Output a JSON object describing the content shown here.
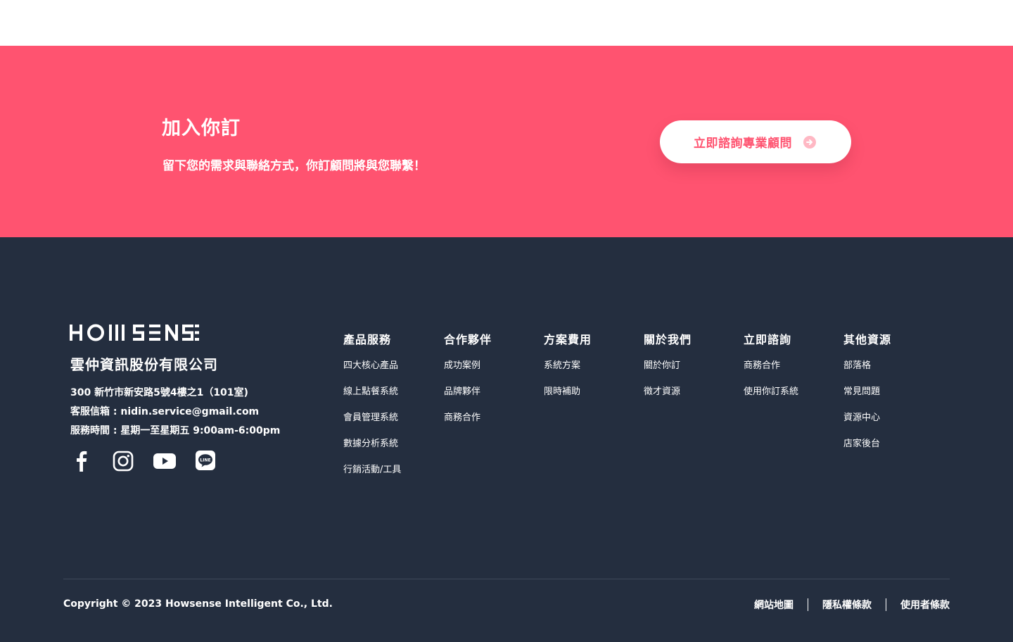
{
  "cta": {
    "title": "加入你訂",
    "subtitle": "留下您的需求與聯絡方式，你訂顧問將與您聯繫！",
    "button_label": "立即諮詢專業顧問",
    "button_icon": "arrow-circle-right-icon",
    "background_color": "#ff5370"
  },
  "footer": {
    "logo_text": "HOWSENSE",
    "company_name": "雲仲資訊股份有限公司",
    "address": "300 新竹市新安路5號4樓之1（101室)",
    "email": "客服信箱 : nidin.service@gmail.com",
    "hours": "服務時間 : 星期一至星期五 9:00am-6:00pm",
    "social": [
      "facebook-icon",
      "instagram-icon",
      "youtube-icon",
      "line-icon"
    ],
    "background_color": "#242e3f",
    "columns": [
      {
        "heading": "產品服務",
        "links": [
          "四大核心產品",
          "線上點餐系統",
          "會員管理系統",
          "數據分析系統",
          "行銷活動/工具"
        ]
      },
      {
        "heading": "合作夥伴",
        "links": [
          "成功案例",
          "品牌夥伴",
          "商務合作"
        ]
      },
      {
        "heading": "方案費用",
        "links": [
          "系統方案",
          "限時補助"
        ]
      },
      {
        "heading": "關於我們",
        "links": [
          "關於你訂",
          "徵才資源"
        ]
      },
      {
        "heading": "立即諮詢",
        "links": [
          "商務合作",
          "使用你訂系統"
        ]
      },
      {
        "heading": "其他資源",
        "links": [
          "部落格",
          "常見問題",
          "資源中心",
          "店家後台"
        ]
      }
    ],
    "copyright": "Copyright © 2023 Howsense Intelligent Co., Ltd.",
    "legal": [
      "網站地圖",
      "隱私權條款",
      "使用者條款"
    ]
  }
}
